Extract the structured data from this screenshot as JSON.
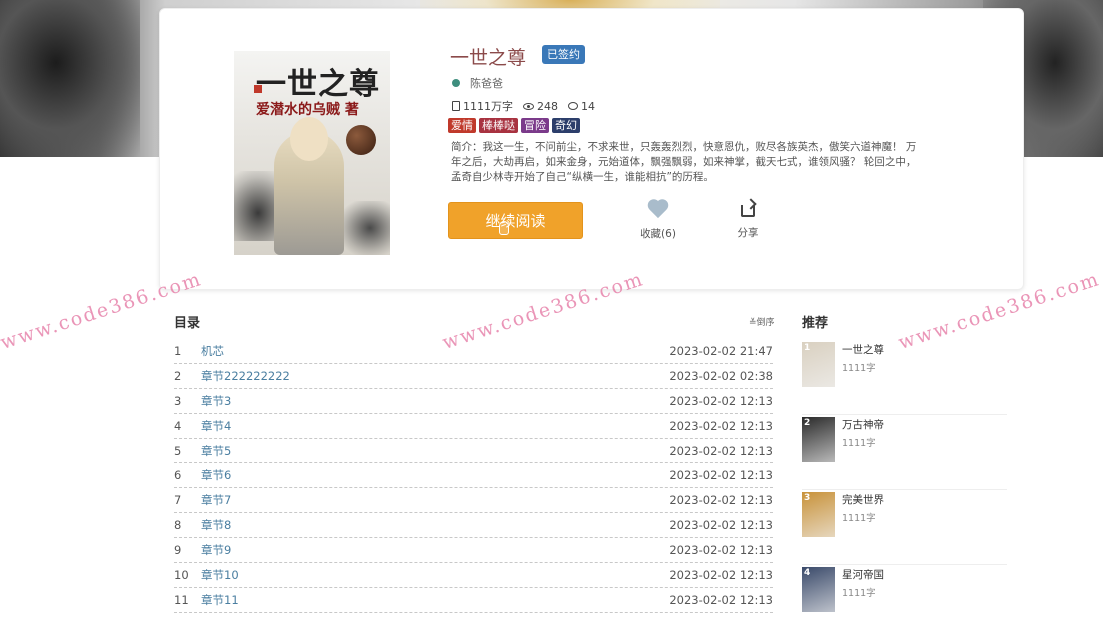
{
  "book": {
    "title": "一世之尊",
    "signed_badge": "已签约",
    "author": "陈爸爸",
    "word_count": "1111万字",
    "views": "248",
    "comments": "14",
    "tags": [
      {
        "label": "爱情",
        "color": "#c0392b"
      },
      {
        "label": "棒棒哒",
        "color": "#a83240"
      },
      {
        "label": "冒险",
        "color": "#7b3a8a"
      },
      {
        "label": "奇幻",
        "color": "#2c3e6b"
      }
    ],
    "intro": "简介：我这一生，不问前尘，不求来世，只轰轰烈烈，快意恩仇，败尽各族英杰，傲笑六道神魔！ 万年之后，大劫再启，如来金身，元始道体，飘强飘弱，如来神掌，截天七式，谁领风骚？ 轮回之中，孟奇自少林寺开始了自己“纵横一生，谁能相抗”的历程。",
    "cover_title": "一世之尊",
    "cover_author": "爱潜水的乌贼 著"
  },
  "actions": {
    "read_label": "继续阅读",
    "favorite_label": "收藏(6)",
    "share_label": "分享"
  },
  "toc": {
    "title": "目录",
    "sort_label": "≚倒序",
    "chapters": [
      {
        "num": "1",
        "name": "机芯",
        "time": "2023-02-02 21:47"
      },
      {
        "num": "2",
        "name": "章节222222222",
        "time": "2023-02-02 02:38"
      },
      {
        "num": "3",
        "name": "章节3",
        "time": "2023-02-02 12:13"
      },
      {
        "num": "4",
        "name": "章节4",
        "time": "2023-02-02 12:13"
      },
      {
        "num": "5",
        "name": "章节5",
        "time": "2023-02-02 12:13"
      },
      {
        "num": "6",
        "name": "章节6",
        "time": "2023-02-02 12:13"
      },
      {
        "num": "7",
        "name": "章节7",
        "time": "2023-02-02 12:13"
      },
      {
        "num": "8",
        "name": "章节8",
        "time": "2023-02-02 12:13"
      },
      {
        "num": "9",
        "name": "章节9",
        "time": "2023-02-02 12:13"
      },
      {
        "num": "10",
        "name": "章节10",
        "time": "2023-02-02 12:13"
      },
      {
        "num": "11",
        "name": "章节11",
        "time": "2023-02-02 12:13"
      }
    ]
  },
  "recommend": {
    "title": "推荐",
    "items": [
      {
        "rank": "1",
        "name": "一世之尊",
        "words": "1111字",
        "cover_color": "#d9d0c0"
      },
      {
        "rank": "2",
        "name": "万古神帝",
        "words": "1111字",
        "cover_color": "#2a2a2a"
      },
      {
        "rank": "3",
        "name": "完美世界",
        "words": "1111字",
        "cover_color": "#c8923a"
      },
      {
        "rank": "4",
        "name": "星河帝国",
        "words": "1111字",
        "cover_color": "#3a4a6a"
      }
    ]
  },
  "watermark": {
    "text": "www.code386.com"
  }
}
